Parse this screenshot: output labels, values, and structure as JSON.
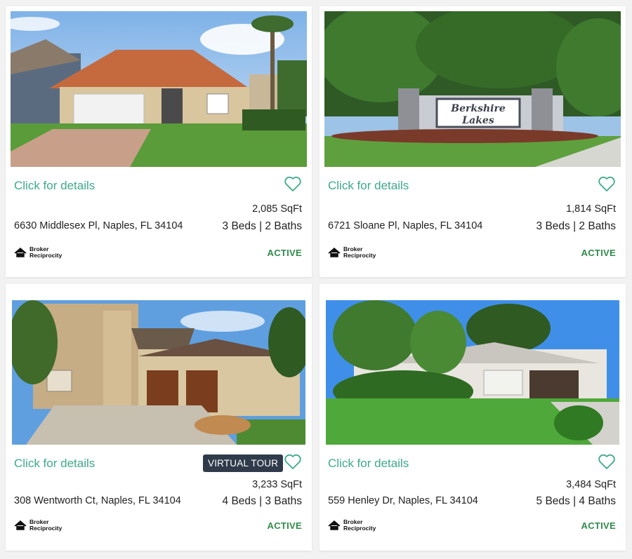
{
  "listings": [
    {
      "details_label": "Click for details",
      "sqft": "2,085 SqFt",
      "address": "6630 Middlesex Pl, Naples, FL 34104",
      "bedbath": "3 Beds | 2 Baths",
      "status": "ACTIVE",
      "logo_line1": "Broker",
      "logo_line2": "Reciprocity"
    },
    {
      "details_label": "Click for details",
      "sqft": "1,814 SqFt",
      "address": "6721 Sloane Pl, Naples, FL 34104",
      "bedbath": "3 Beds | 2 Baths",
      "status": "ACTIVE",
      "logo_line1": "Broker",
      "logo_line2": "Reciprocity",
      "sign_line1": "Berkshire",
      "sign_line2": "Lakes"
    },
    {
      "details_label": "Click for details",
      "badge": "VIRTUAL TOUR",
      "sqft": "3,233 SqFt",
      "address": "308 Wentworth Ct, Naples, FL 34104",
      "bedbath": "4 Beds | 3 Baths",
      "status": "ACTIVE",
      "logo_line1": "Broker",
      "logo_line2": "Reciprocity"
    },
    {
      "details_label": "Click for details",
      "sqft": "3,484 SqFt",
      "address": "559 Henley Dr, Naples, FL 34104",
      "bedbath": "5 Beds | 4 Baths",
      "status": "ACTIVE",
      "logo_line1": "Broker",
      "logo_line2": "Reciprocity"
    }
  ],
  "icons": {
    "favorite": "heart-outline-icon",
    "logo": "house-icon"
  },
  "colors": {
    "accent": "#3daa8c",
    "status": "#2f8a4a",
    "badge_bg": "#2f3b4a",
    "page_bg": "#f2f2f2"
  }
}
